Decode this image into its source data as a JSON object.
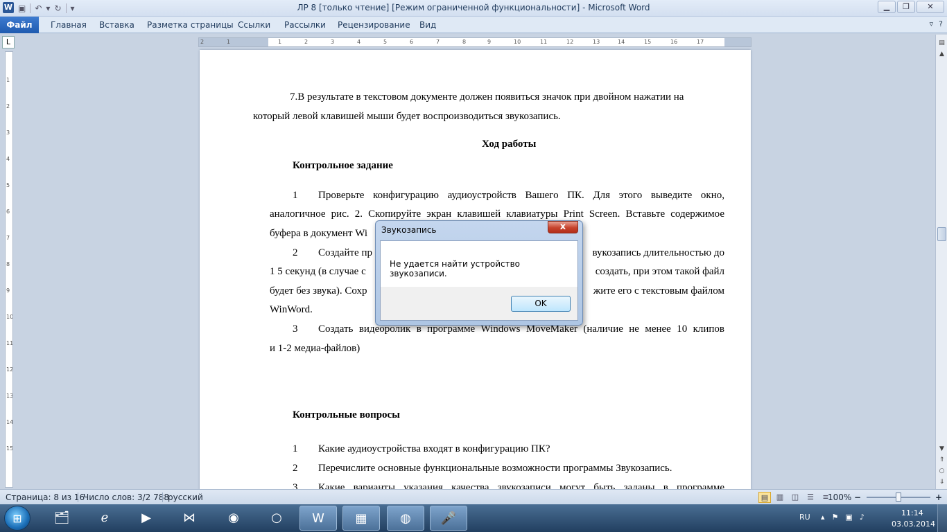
{
  "window": {
    "title": "ЛР 8 [только чтение] [Режим ограниченной функциональности]  -  Microsoft Word",
    "logo": "W",
    "qat_icons": [
      "save-icon",
      "undo-icon",
      "redo-icon",
      "customize-icon"
    ],
    "controls": [
      "minimize-icon",
      "restore-icon",
      "close-icon"
    ]
  },
  "ribbon": {
    "file_tab": "Файл",
    "tabs": [
      "Главная",
      "Вставка",
      "Разметка страницы",
      "Ссылки",
      "Рассылки",
      "Рецензирование",
      "Вид"
    ]
  },
  "ruler": {
    "h_ticks": [
      "2",
      "1",
      "1",
      "2",
      "3",
      "4",
      "5",
      "6",
      "7",
      "8",
      "9",
      "10",
      "11",
      "12",
      "13",
      "14",
      "15",
      "16",
      "17"
    ],
    "v_ticks": [
      "1",
      "2",
      "3",
      "4",
      "5",
      "6",
      "7",
      "8",
      "9",
      "10",
      "11",
      "12",
      "13",
      "14",
      "15"
    ]
  },
  "document": {
    "para7_line1": "7.В результате в текстовом документе должен появиться значок  при двойном нажатии на",
    "para7_line2": "который левой клавишей мыши будет воспроизводиться звукозапись.",
    "heading_work": "Ход работы",
    "heading_task": "Контрольное  задание",
    "task1_num": "1",
    "task1_line1": "Проверьте  конфигурацию  аудиоустройств  Вашего  ПК.  Для  этого  выведите  окно,",
    "task1_line2": "аналогичное рис. 2. Скопируйте экран клавишей клавиатуры Print Screen. Вставьте содержимое",
    "task1_line3": "буфера в документ Wi",
    "task2_num": "2",
    "task2_line1_a": "Создайте пр",
    "task2_line1_b": "вукозапись длительностью до",
    "task2_line2_a": "1 5   секунд (в случае с",
    "task2_line2_b": "создать, при этом такой файл",
    "task2_line3_a": "будет без звука). Сохр",
    "task2_line3_b": "жите его с текстовым файлом",
    "task2_line4": "WinWord.",
    "task3_num": "3",
    "task3_line1": "Создать  видеоролик  в  программе  Windows  MoveMaker  (наличие  не  менее  10  клипов",
    "task3_line2": "и 1-2 медиа-файлов)",
    "heading_questions": "Контрольные вопросы",
    "q1_num": "1",
    "q1": "Какие аудиоустройства входят в конфигурацию ПК?",
    "q2_num": "2",
    "q2": "Перечислите основные функциональные возможности программы Звукозапись.",
    "q3_num": "3",
    "q3": "Какие  варианты  указания  качества  звукозаписи  могут  быть  заданы  в  программе"
  },
  "dialog": {
    "title": "Звукозапись",
    "close": "x",
    "message": "Не удается найти устройство звукозаписи.",
    "ok": "OK"
  },
  "statusbar": {
    "page": "Страница: 8 из 16",
    "words": "Число слов: 3/2 788",
    "language": "русский",
    "zoom": "100%",
    "zoom_minus": "−",
    "zoom_plus": "+",
    "zoom_level_percent": 100
  },
  "taskbar": {
    "apps": [
      "explorer-icon",
      "ie-icon",
      "media-player-icon",
      "visual-studio-icon",
      "chrome-icon",
      "opera-icon",
      "word-icon",
      "control-panel-icon",
      "speaker-app-icon",
      "sound-recorder-icon"
    ],
    "language": "RU",
    "time": "11:14",
    "date": "03.03.2014"
  }
}
